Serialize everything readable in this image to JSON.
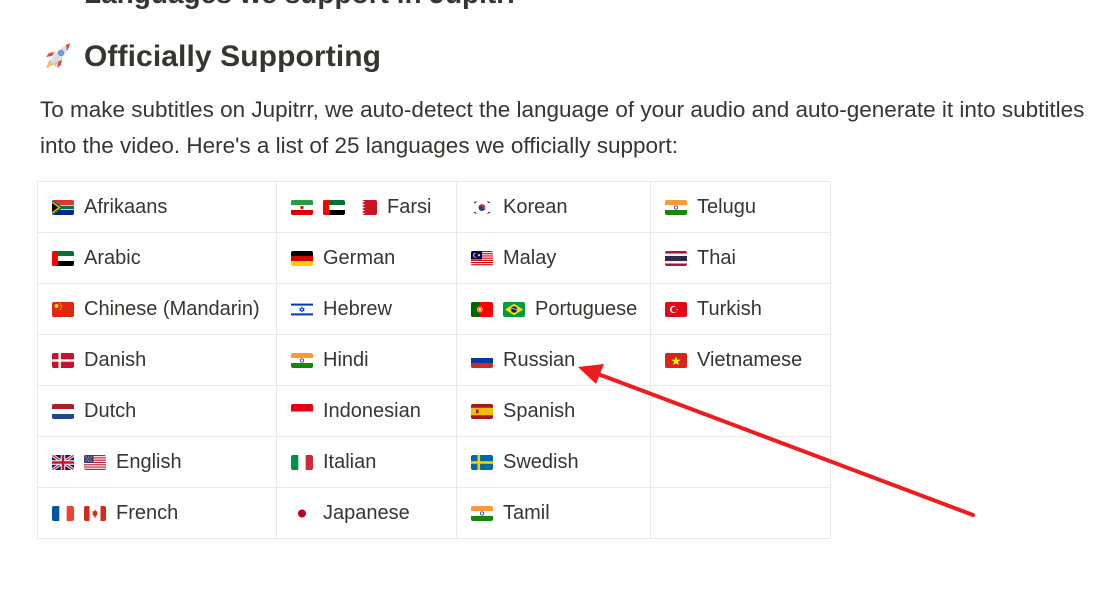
{
  "cut_heading": "Languages we support in Jupitrr",
  "section": {
    "icon": "rocket-icon",
    "heading": "Officially Supporting",
    "intro": "To make subtitles on Jupitrr, we auto-detect the language of your audio and auto-generate it into subtitles into the video. Here's a list of 25 languages we officially support:"
  },
  "table": {
    "rows": [
      [
        {
          "flags": [
            "za"
          ],
          "label": "Afrikaans"
        },
        {
          "flags": [
            "ir",
            "ae",
            "bh"
          ],
          "label": "Farsi"
        },
        {
          "flags": [
            "kr"
          ],
          "label": "Korean"
        },
        {
          "flags": [
            "in"
          ],
          "label": "Telugu"
        }
      ],
      [
        {
          "flags": [
            "ae"
          ],
          "label": "Arabic"
        },
        {
          "flags": [
            "de"
          ],
          "label": "German"
        },
        {
          "flags": [
            "my"
          ],
          "label": "Malay"
        },
        {
          "flags": [
            "th"
          ],
          "label": "Thai"
        }
      ],
      [
        {
          "flags": [
            "cn"
          ],
          "label": "Chinese (Mandarin)"
        },
        {
          "flags": [
            "il"
          ],
          "label": "Hebrew"
        },
        {
          "flags": [
            "pt",
            "br"
          ],
          "label": "Portuguese"
        },
        {
          "flags": [
            "tr"
          ],
          "label": "Turkish"
        }
      ],
      [
        {
          "flags": [
            "dk"
          ],
          "label": "Danish"
        },
        {
          "flags": [
            "in"
          ],
          "label": "Hindi"
        },
        {
          "flags": [
            "ru"
          ],
          "label": "Russian"
        },
        {
          "flags": [
            "vn"
          ],
          "label": "Vietnamese"
        }
      ],
      [
        {
          "flags": [
            "nl"
          ],
          "label": "Dutch"
        },
        {
          "flags": [
            "id"
          ],
          "label": "Indonesian"
        },
        {
          "flags": [
            "es"
          ],
          "label": "Spanish"
        },
        null
      ],
      [
        {
          "flags": [
            "gb",
            "us"
          ],
          "label": "English"
        },
        {
          "flags": [
            "it"
          ],
          "label": "Italian"
        },
        {
          "flags": [
            "se"
          ],
          "label": "Swedish"
        },
        null
      ],
      [
        {
          "flags": [
            "fr",
            "ca"
          ],
          "label": "French"
        },
        {
          "flags": [
            "jp"
          ],
          "label": "Japanese"
        },
        {
          "flags": [
            "in"
          ],
          "label": "Tamil"
        },
        null
      ]
    ]
  },
  "annotation": {
    "color": "#ee1c1c",
    "points_to": "Russian"
  }
}
